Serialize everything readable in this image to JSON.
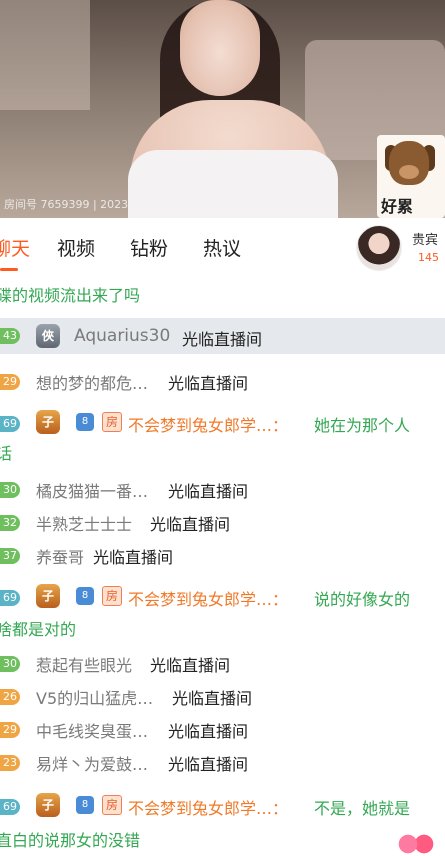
{
  "video": {
    "room_id_text": "房间号 7659399 | 2023",
    "mascot_text": "好累"
  },
  "tabs": [
    "聊天",
    "视频",
    "钻粉",
    "热议"
  ],
  "vip": {
    "label": "贵宾",
    "count": "145"
  },
  "chat": [
    {
      "level": "",
      "name": "",
      "text": "碟的视频流出来了吗",
      "kind": "top-msg"
    },
    {
      "level": "43",
      "name": "Aquarius30",
      "text": "光临直播间",
      "kind": "enter-highlight"
    },
    {
      "level": "29",
      "name": "想的梦的都危…",
      "text": "光临直播间",
      "kind": "enter"
    },
    {
      "level": "69",
      "name": "不会梦到兔女郎学…：",
      "text": "她在为那个人",
      "text2": "话",
      "kind": "message"
    },
    {
      "level": "30",
      "name": "橘皮猫猫一番…",
      "text": "光临直播间",
      "kind": "enter"
    },
    {
      "level": "32",
      "name": "半熟芝士士士",
      "text": "光临直播间",
      "kind": "enter"
    },
    {
      "level": "37",
      "name": "养蚕哥",
      "text": "光临直播间",
      "kind": "enter"
    },
    {
      "level": "69",
      "name": "不会梦到兔女郎学…：",
      "text": "说的好像女的",
      "text2": "啥都是对的",
      "kind": "message"
    },
    {
      "level": "30",
      "name": "惹起有些眼光",
      "text": "光临直播间",
      "kind": "enter"
    },
    {
      "level": "26",
      "name": "V5的归山猛虎…",
      "text": "光临直播间",
      "kind": "enter"
    },
    {
      "level": "29",
      "name": "中毛线奖臭蛋…",
      "text": "光临直播间",
      "kind": "enter"
    },
    {
      "level": "23",
      "name": "易烊丶为爱鼓…",
      "text": "光临直播间",
      "kind": "enter"
    },
    {
      "level": "69",
      "name": "不会梦到兔女郎学…：",
      "text": "不是，她就是",
      "text2": "直白的说那女的没错",
      "kind": "message"
    }
  ],
  "badges": {
    "fan_badge": "子",
    "room_badge": "房",
    "blue_badge": "8",
    "grey_badge": "俠"
  },
  "colors": {
    "accent": "#ff5a1f",
    "level_green": "#6fbf5f",
    "message_green": "#34a853",
    "sender_orange": "#f07a2a"
  }
}
